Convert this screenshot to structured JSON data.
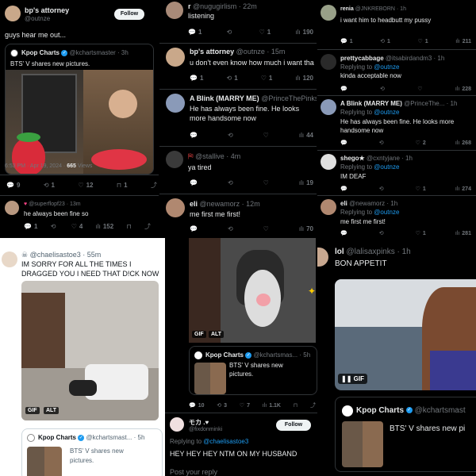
{
  "p1": {
    "name": "bp's attorney",
    "handle": "@outnze",
    "follow": "Follow",
    "text": "guys hear me out...",
    "quote": {
      "name": "Kpop Charts",
      "handle": "@kchartsmaster · 3h",
      "text": "BTS' V shares new pictures."
    },
    "meta_time": "6:53 PM · Apr 19, 2024 · ",
    "meta_views": "665",
    "meta_views_label": " Views",
    "acts": [
      "9",
      "1",
      "12",
      "1"
    ],
    "reply": {
      "handle": "@superflopf23 · 13m",
      "text": "he always been fine so",
      "acts": [
        "1",
        "",
        "4",
        "152"
      ]
    }
  },
  "p2": {
    "t1": {
      "name": "r",
      "handle": "@nugugirlism · 22m",
      "text": "listening",
      "acts": [
        "1",
        "",
        "1",
        "190"
      ]
    },
    "t2": {
      "name": "bp's attorney",
      "handle": "@outnze · 15m",
      "text": "u don't even know how much i want tha",
      "acts": [
        "1",
        "1",
        "1",
        "120"
      ]
    },
    "t3": {
      "name": "A Blink (MARRY ME)",
      "handle": "@PrinceThePinks",
      "text": "He has always been fine. He looks more handsome now",
      "acts": [
        "",
        "",
        "",
        "44"
      ]
    },
    "t4": {
      "name": "",
      "handle": "@stallive · 4m",
      "text": "ya tired",
      "acts": [
        "",
        "",
        "",
        "19"
      ]
    },
    "t5": {
      "name": "eli",
      "handle": "@newamorz · 12m",
      "text": "me first me first!",
      "acts": [
        "",
        "",
        "",
        "70"
      ]
    }
  },
  "p3": {
    "t1": {
      "name": "renia",
      "handle": "@JNKREBORN · 1h",
      "text": "i want him to headbutt my pussy",
      "acts": [
        "1",
        "1",
        "1",
        "211"
      ]
    },
    "t2": {
      "name": "prettycabbage",
      "handle": "@itsabirdandm3 · 1h",
      "reply_to": "@outnze",
      "text": "kinda acceptable now",
      "acts": [
        "",
        "",
        "",
        "228"
      ]
    },
    "t3": {
      "name": "A Blink (MARRY ME)",
      "handle": "@PrinceThe... · 1h",
      "reply_to": "@outnze",
      "text": "He has always been fine. He looks more handsome now",
      "acts": [
        "",
        "",
        "2",
        "268"
      ]
    },
    "t4": {
      "name": "shego★",
      "handle": "@cxntyjane · 1h",
      "reply_to": "@outnze",
      "text": "IM DEAF",
      "acts": [
        "",
        "",
        "1",
        "274"
      ]
    },
    "t5": {
      "name": "eli",
      "handle": "@newamorz · 1h",
      "reply_to": "@outnze",
      "text": "me first me first!",
      "acts": [
        "",
        "",
        "1",
        "281"
      ]
    },
    "replying": "Replying to "
  },
  "p4": {
    "handle": "@chaelisastoe3 · 55m",
    "text": "IM SORRY FOR ALL THE TIMES I DRAGGED YOU I NEED THAT D!CK NOW",
    "gif": "GIF",
    "alt": "ALT",
    "quote": {
      "name": "Kpop Charts",
      "handle": "@kchartsmast... · 5h",
      "text": "BTS' V shares new pictures."
    }
  },
  "p5": {
    "gif": "GIF",
    "alt": "ALT",
    "quote": {
      "name": "Kpop Charts",
      "handle": "@kchartsmas... · 5h",
      "text": "BTS' V shares new pictures."
    },
    "acts": [
      "10",
      "3",
      "7",
      "1.1K"
    ],
    "reply": {
      "name": "モカ .♥",
      "handle": "@fixdonminki",
      "follow": "Follow",
      "replying": "Replying to ",
      "reply_to": "@chaelisastoe3",
      "text": "HEY HEY HEY NTM ON MY HUSBAND",
      "post_reply": "Post your reply"
    }
  },
  "p6": {
    "name": "lol",
    "handle": "@lalisaxpinks · 1h",
    "text": "BON APPETIT",
    "gif": "GIF",
    "quote": {
      "name": "Kpop Charts",
      "handle": "@kchartsmast",
      "text": "BTS' V shares new pi"
    }
  },
  "colors": {
    "accent": "#1d9bf0",
    "strawberry": "#d92b3a",
    "lips": "#e03545"
  }
}
